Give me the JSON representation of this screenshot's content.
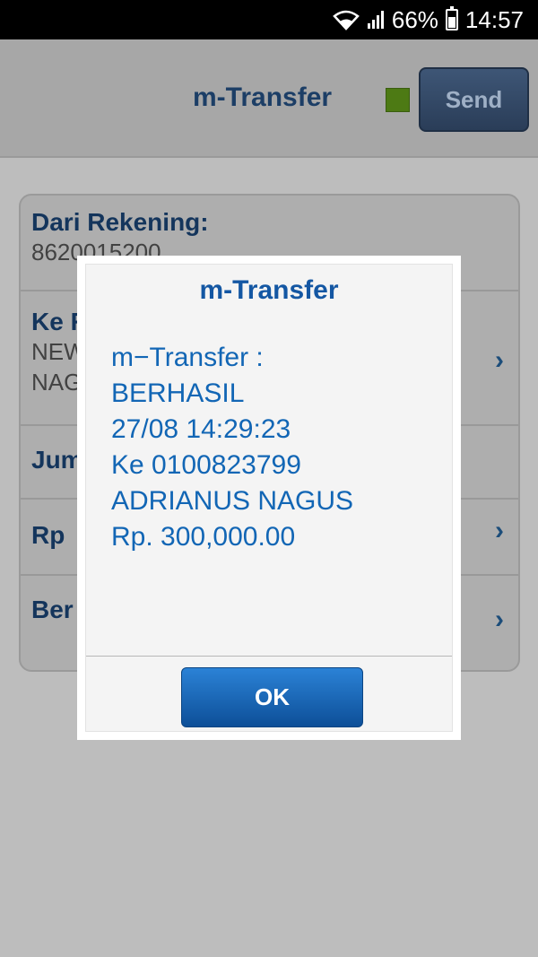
{
  "status_bar": {
    "battery": "66%",
    "time": "14:57"
  },
  "app": {
    "title": "m-Transfer",
    "send_label": "Send",
    "indicator_color": "#4d7a14",
    "form": {
      "from_label": "Dari Rekening:",
      "from_value": "8620015200",
      "to_label": "Ke R",
      "to_value_line1": "NEW",
      "to_value_line2": "NAG",
      "amount_label": "Jum",
      "currency_label": "Rp",
      "news_label": "Ber"
    }
  },
  "dialog": {
    "title": "m-Transfer",
    "message": [
      "m−Transfer :",
      "BERHASIL",
      "27/08 14:29:23",
      "Ke 0100823799",
      "ADRIANUS NAGUS",
      "Rp. 300,000.00"
    ],
    "ok_label": "OK"
  }
}
